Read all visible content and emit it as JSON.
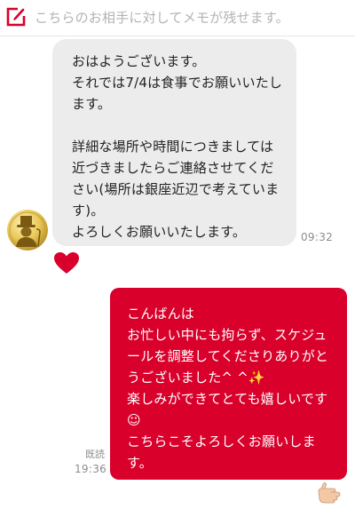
{
  "memo": {
    "placeholder": "こちらのお相手に対してメモが残せます。",
    "icon": "memo-edit-icon",
    "accent_color": "#d9002b"
  },
  "partner": {
    "avatar_icon": "gold-coin-gentleman-avatar"
  },
  "messages": {
    "incoming": {
      "lines": [
        "おはようございます。",
        "それでは7/4は食事でお願いいたし",
        "ます。",
        "",
        "詳細な場所や時間につきましては",
        "近づきましたらご連絡させてくだ",
        "さい(場所は銀座近辺で考えていま",
        "す)。",
        "よろしくお願いいたします。"
      ],
      "time": "09:32",
      "bubble_color": "#ececec"
    },
    "reaction": {
      "icon": "heart-icon",
      "color": "#d9002b"
    },
    "outgoing": {
      "lines": [
        "こんばんは",
        "お忙しい中にも拘らず、スケジュ",
        "ールを調整してくださりありがと",
        "うございました^ ^✨",
        "楽しみができてとても嬉しいです",
        "☺",
        "こちらこそよろしくお願いしま",
        "す。"
      ],
      "read_label": "既読",
      "time": "19:36",
      "bubble_color": "#d9002b"
    },
    "pointing_reaction": {
      "icon": "pointing-hand-icon"
    }
  }
}
